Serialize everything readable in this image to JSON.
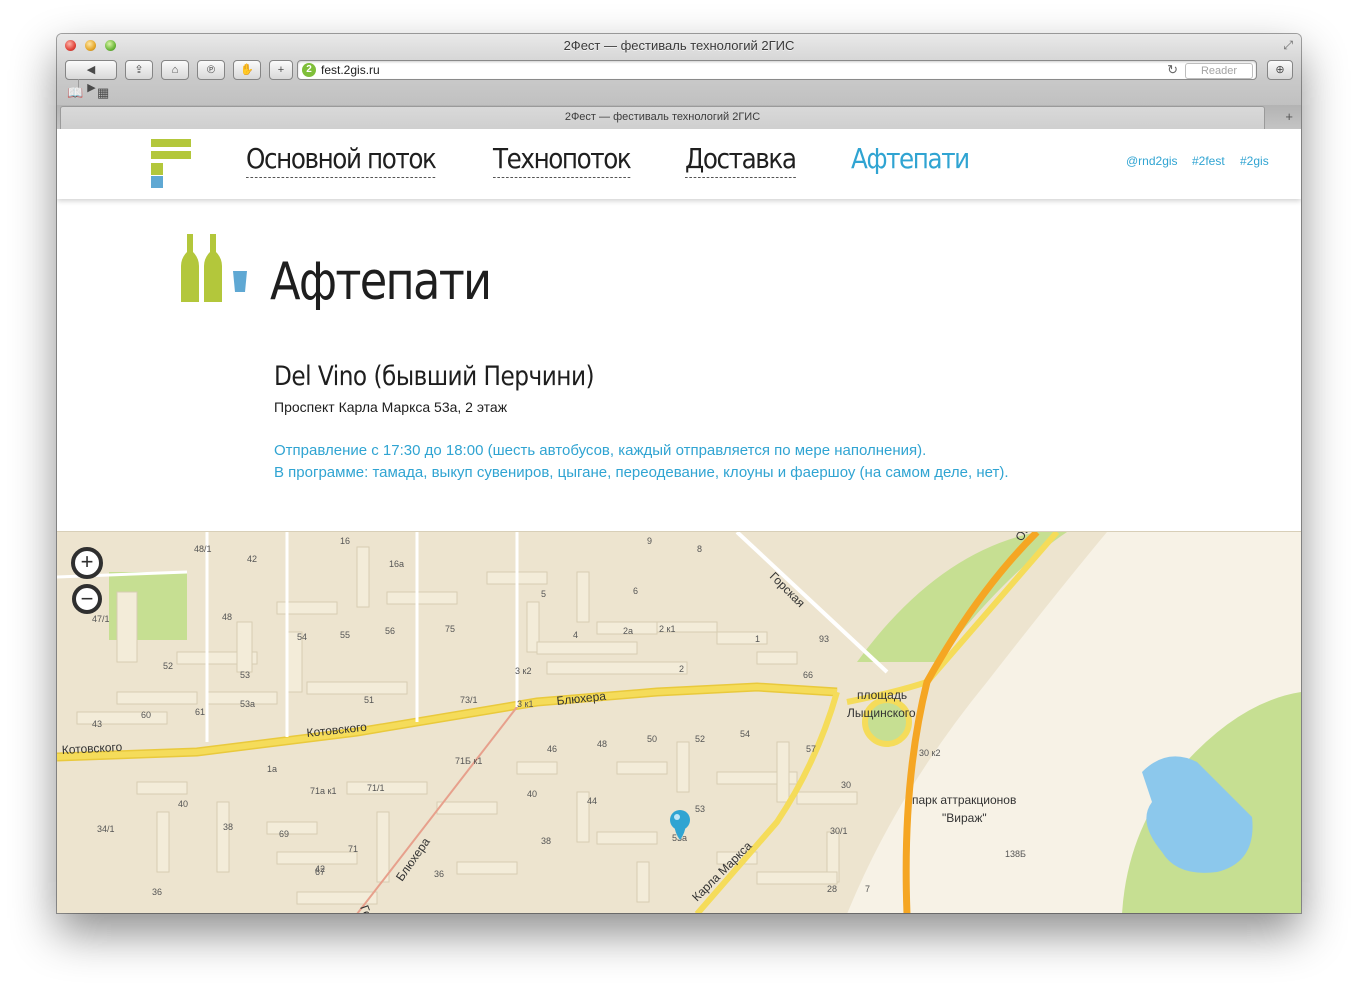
{
  "browser": {
    "window_title": "2Фест — фестиваль технологий 2ГИС",
    "url": "fest.2gis.ru",
    "favicon_label": "2",
    "reader_label": "Reader",
    "tab_title": "2Фест — фестиваль технологий 2ГИС",
    "icons": {
      "back": "◀",
      "forward": "▶",
      "share": "⇪",
      "home": "⌂",
      "pinterest": "℗",
      "evernote": "✋",
      "add": "+",
      "reload": "↻",
      "downloads": "⊕",
      "bookmarks": "📖",
      "top_sites": "▦",
      "new_tab": "+",
      "fullscreen": "⤢"
    }
  },
  "header": {
    "nav": [
      {
        "label": "Основной поток"
      },
      {
        "label": "Технопоток"
      },
      {
        "label": "Доставка"
      },
      {
        "label": "Афтепати"
      }
    ],
    "social": [
      "@rnd2gis",
      "#2fest",
      "#2gis"
    ]
  },
  "main": {
    "title": "Афтепати",
    "venue_name": "Del Vino (бывший Перчини)",
    "venue_address": "Проспект Карла Маркса 53а, 2 этаж",
    "info_lines": [
      "Отправление с 17:30 до 18:00 (шесть автобусов, каждый отправляется по мере наполнения).",
      "В программе: тамада, выкуп сувениров, цыгане, переодевание, клоуны и фаершоу (на самом деле, нет)."
    ]
  },
  "map": {
    "zoom_in": "+",
    "zoom_out": "−",
    "streets": [
      "Блюхера",
      "Блюхера",
      "Котовского",
      "Котовского",
      "Горская",
      "Карла Маркса",
      "Геоде",
      "Ок"
    ],
    "place_labels": [
      "площадь",
      "Лыщинского",
      "парк аттракционов",
      "\"Вираж\""
    ],
    "house_numbers": [
      "16",
      "16а",
      "48/1",
      "42",
      "9",
      "8",
      "5",
      "6",
      "48",
      "47/1",
      "54",
      "55",
      "56",
      "75",
      "4",
      "2а",
      "2 к1",
      "1",
      "93",
      "52",
      "53",
      "3 к2",
      "2",
      "66",
      "51",
      "73/1",
      "3 к1",
      "53а",
      "60",
      "61",
      "43",
      "46",
      "48",
      "50",
      "52",
      "54",
      "57",
      "71Б к1",
      "1а",
      "71а к1",
      "71/1",
      "40",
      "40",
      "44",
      "53",
      "30",
      "30 к2",
      "34/1",
      "38",
      "69",
      "71",
      "42",
      "38",
      "53а",
      "30/1",
      "138Б",
      "36",
      "67",
      "36",
      "28",
      "7"
    ]
  },
  "colors": {
    "accent": "#30a4d2",
    "logo_green": "#b3c73b",
    "logo_blue": "#5fa8d3",
    "map_bg": "#ede4cf",
    "map_road": "#f5dc5a",
    "map_highway": "#f5a623",
    "map_park": "#c6df92",
    "map_water": "#8cc8ec"
  }
}
